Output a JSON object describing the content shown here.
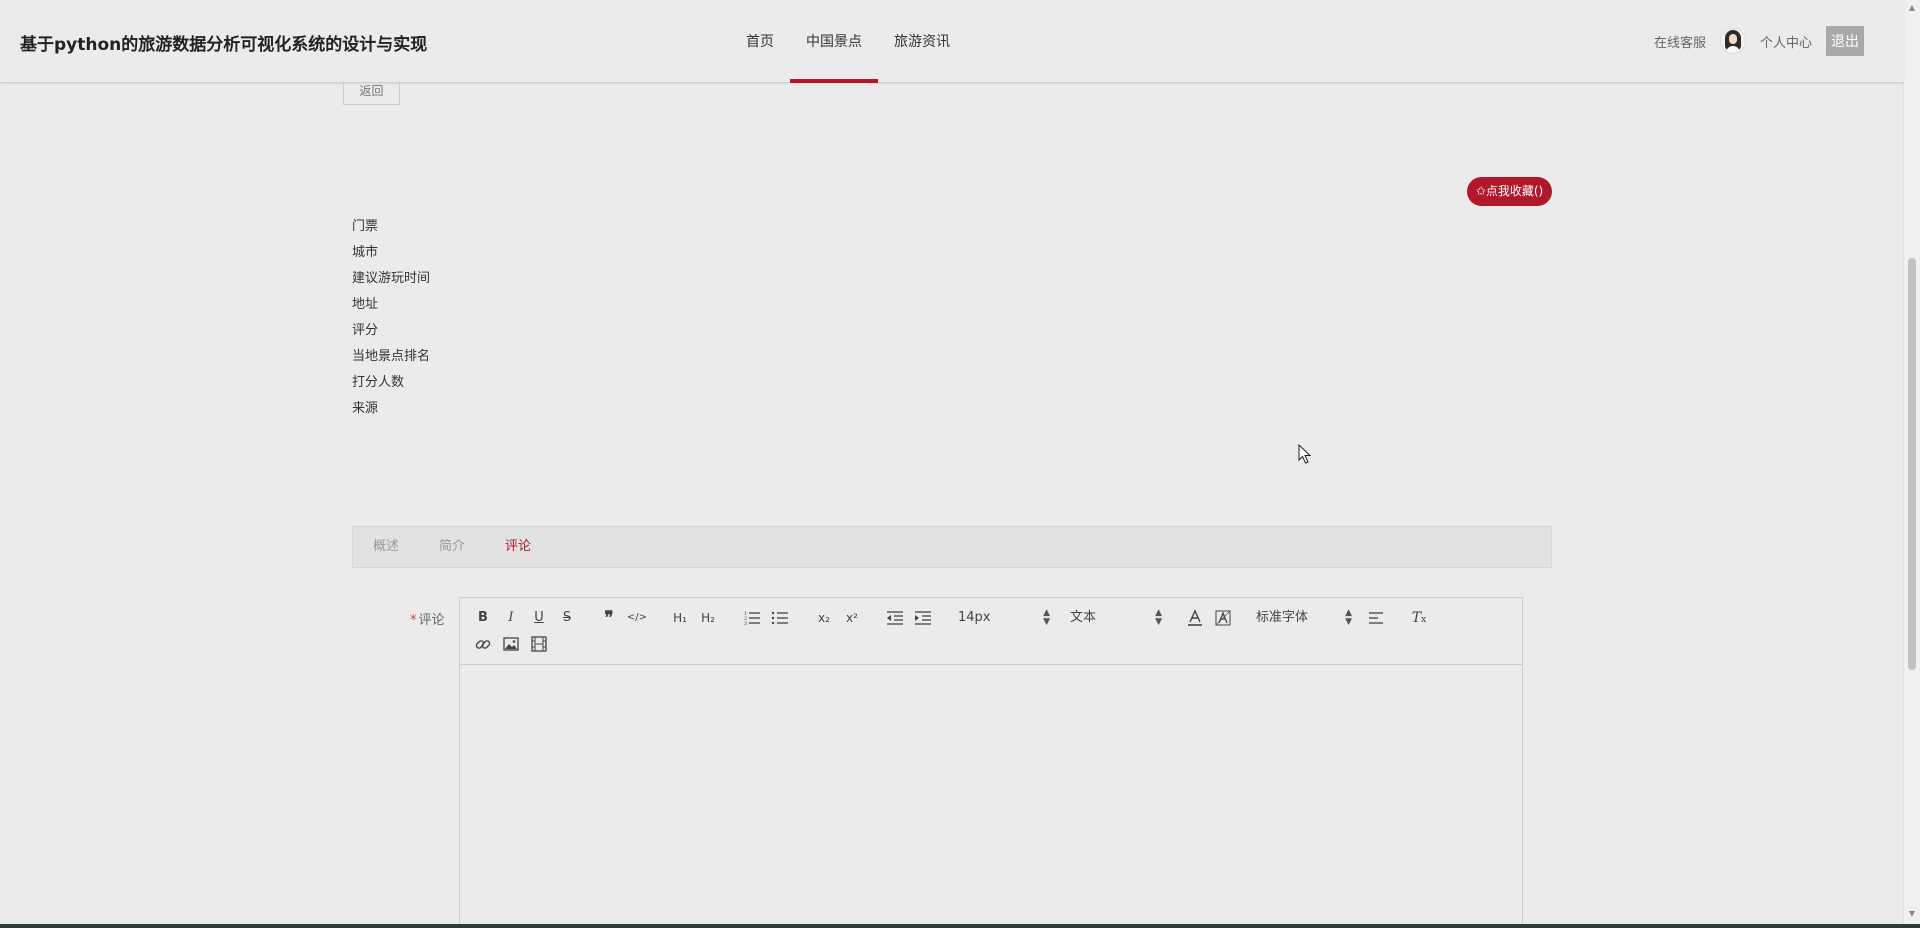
{
  "header": {
    "site_title": "基于python的旅游数据分析可视化系统的设计与实现",
    "nav": [
      {
        "label": "首页",
        "active": false
      },
      {
        "label": "中国景点",
        "active": true
      },
      {
        "label": "旅游资讯",
        "active": false
      }
    ],
    "online_service": "在线客服",
    "profile": "个人中心",
    "logout": "退出"
  },
  "back_button": "返回",
  "favorite_button": "✩点我收藏()",
  "fields": [
    "门票",
    "城市",
    "建议游玩时间",
    "地址",
    "评分",
    "当地景点排名",
    "打分人数",
    "来源"
  ],
  "tabs": [
    {
      "label": "概述",
      "active": false
    },
    {
      "label": "简介",
      "active": false
    },
    {
      "label": "评论",
      "active": true
    }
  ],
  "comment": {
    "required_mark": "*",
    "label": "评论",
    "font_size_value": "14px",
    "header_value": "文本",
    "font_family_value": "标准字体"
  },
  "colors": {
    "accent": "#b3172a",
    "background": "#ebebeb"
  }
}
